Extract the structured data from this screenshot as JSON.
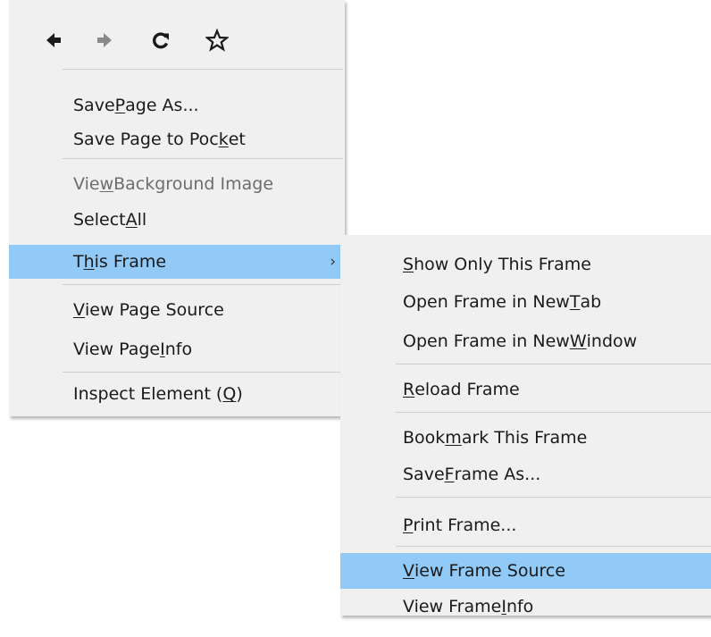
{
  "main_menu": {
    "nav_icons": [
      "back-arrow-icon",
      "forward-arrow-icon",
      "reload-icon",
      "bookmark-star-icon"
    ],
    "items": [
      {
        "before": "Save ",
        "key": "P",
        "after": "age As..."
      },
      {
        "before": "Save Page to Poc",
        "key": "k",
        "after": "et"
      },
      {
        "before": "Vie",
        "key": "w",
        "after": " Background Image"
      },
      {
        "before": "Select ",
        "key": "A",
        "after": "ll"
      },
      {
        "before": "T",
        "key": "h",
        "after": "is Frame"
      },
      {
        "before": "",
        "key": "V",
        "after": "iew Page Source"
      },
      {
        "before": "View Page ",
        "key": "I",
        "after": "nfo"
      },
      {
        "before": "Inspect Element (",
        "key": "Q",
        "after": ")"
      }
    ],
    "submenu_arrow": "›"
  },
  "sub_menu": {
    "items": [
      {
        "before": "",
        "key": "S",
        "after": "how Only This Frame"
      },
      {
        "before": "Open Frame in New ",
        "key": "T",
        "after": "ab"
      },
      {
        "before": "Open Frame in New ",
        "key": "W",
        "after": "indow"
      },
      {
        "before": "",
        "key": "R",
        "after": "eload Frame"
      },
      {
        "before": "Book",
        "key": "m",
        "after": "ark This Frame"
      },
      {
        "before": "Save ",
        "key": "F",
        "after": "rame As..."
      },
      {
        "before": "",
        "key": "P",
        "after": "rint Frame..."
      },
      {
        "before": "",
        "key": "V",
        "after": "iew Frame Source"
      },
      {
        "before": "View Frame ",
        "key": "I",
        "after": "nfo"
      }
    ]
  },
  "colors": {
    "menu_bg": "#f0f0f0",
    "highlight": "#91c9f7",
    "disabled_text": "#6d6d6d",
    "separator": "#cfcfcf"
  }
}
